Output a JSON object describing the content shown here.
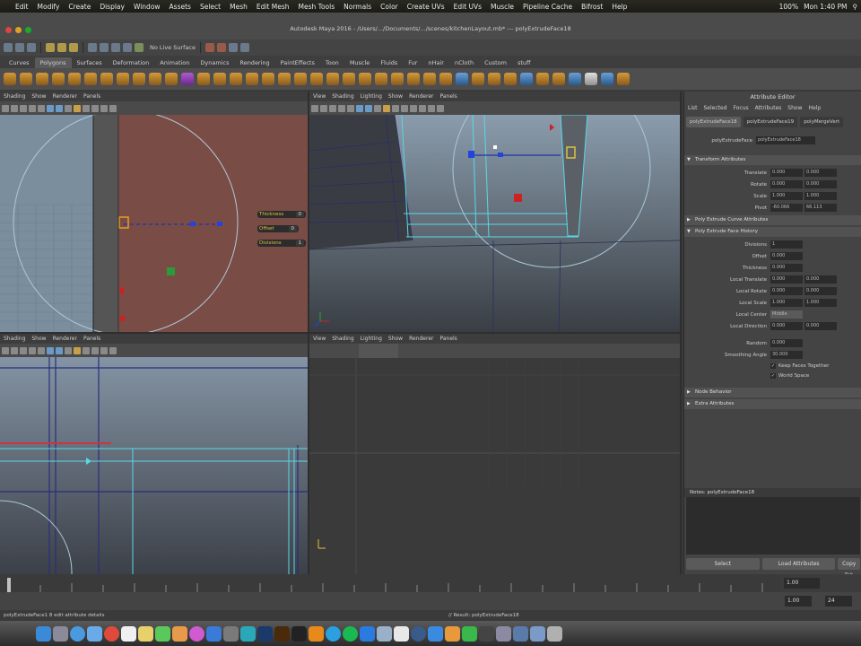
{
  "mac_menu": {
    "items": [
      "Edit",
      "Modify",
      "Create",
      "Display",
      "Window",
      "Assets",
      "Select",
      "Mesh",
      "Edit Mesh",
      "Mesh Tools",
      "Normals",
      "Color",
      "Create UVs",
      "Edit UVs",
      "Muscle",
      "Pipeline Cache",
      "Bifrost",
      "Help"
    ],
    "battery": "100%",
    "clock": "Mon 1:40 PM"
  },
  "window": {
    "title": "Autodesk Maya 2016 - /Users/.../Documents/.../scenes/kitchenLayout.mb* --- polyExtrudeFace18"
  },
  "statusline": {
    "symmetry_label": "No Live Surface"
  },
  "shelf_tabs": [
    "Curves",
    "Polygons",
    "Surfaces",
    "Deformation",
    "Animation",
    "Dynamics",
    "Rendering",
    "PaintEffects",
    "Toon",
    "Muscle",
    "Fluids",
    "Fur",
    "nHair",
    "nCloth",
    "Custom",
    "stuff"
  ],
  "panels": {
    "menu": [
      "View",
      "Shading",
      "Lighting",
      "Show",
      "Renderer",
      "Panels"
    ],
    "menu_left": [
      "Shading",
      "Show",
      "Renderer",
      "Panels"
    ],
    "extrude_hud": {
      "thickness_label": "Thickness",
      "thickness_value": "0",
      "offset_label": "Offset",
      "offset_value": "0",
      "divisions_label": "Divisions",
      "divisions_value": "1"
    }
  },
  "attribute_editor": {
    "title": "Attribute Editor",
    "menu": [
      "List",
      "Selected",
      "Focus",
      "Attributes",
      "Show",
      "Help"
    ],
    "tabs": [
      "polyExtrudeFace18",
      "polyExtrudeFace19",
      "polyMergeVert"
    ],
    "node_label": "polyExtrudeFace",
    "node_name": "polyExtrudeFace18",
    "sections": {
      "transform": "Transform Attributes",
      "curve": "Poly Extrude Curve Attributes",
      "face": "Poly Extrude Face History",
      "node_behavior": "Node Behavior",
      "extra": "Extra Attributes"
    },
    "transform_rows": [
      {
        "label": "Translate",
        "a": "0.000",
        "b": "0.000"
      },
      {
        "label": "Rotate",
        "a": "0.000",
        "b": "0.000"
      },
      {
        "label": "Scale",
        "a": "1.000",
        "b": "1.000"
      },
      {
        "label": "Pivot",
        "a": "-60.066",
        "b": "66.113"
      }
    ],
    "face_rows": [
      {
        "label": "Divisions",
        "a": "1"
      },
      {
        "label": "Offset",
        "a": "0.000"
      },
      {
        "label": "Thickness",
        "a": "0.000"
      },
      {
        "label": "Local Translate",
        "a": "0.000",
        "b": "0.000"
      },
      {
        "label": "Local Rotate",
        "a": "0.000",
        "b": "0.000"
      },
      {
        "label": "Local Scale",
        "a": "1.000",
        "b": "1.000"
      },
      {
        "label": "Local Center",
        "a": "Middle"
      },
      {
        "label": "Local Direction",
        "a": "0.000",
        "b": "0.000"
      },
      {
        "label": "Random",
        "a": "0.000"
      },
      {
        "label": "Smoothing Angle",
        "a": "30.000"
      }
    ],
    "checkboxes": [
      "Keep Faces Together",
      "World Space"
    ],
    "notes_label": "Notes: polyExtrudeFace18",
    "buttons": [
      "Select",
      "Load Attributes",
      "Copy Tab"
    ]
  },
  "timeslider": {
    "current_frame": "1.00",
    "start": "1.00",
    "end": "24"
  },
  "command_line": {
    "result": "// Result: polyExtrudeFace18",
    "help": "polyExtrudeFace1 8 edit attribute details"
  },
  "colors": {
    "maya_bg": "#444444",
    "viewport_sky": "#8a9aaa",
    "selection_cyan": "#5ad8e6",
    "side_view_red": "#7a4a44",
    "manipulator_yellow": "#e0c040"
  }
}
